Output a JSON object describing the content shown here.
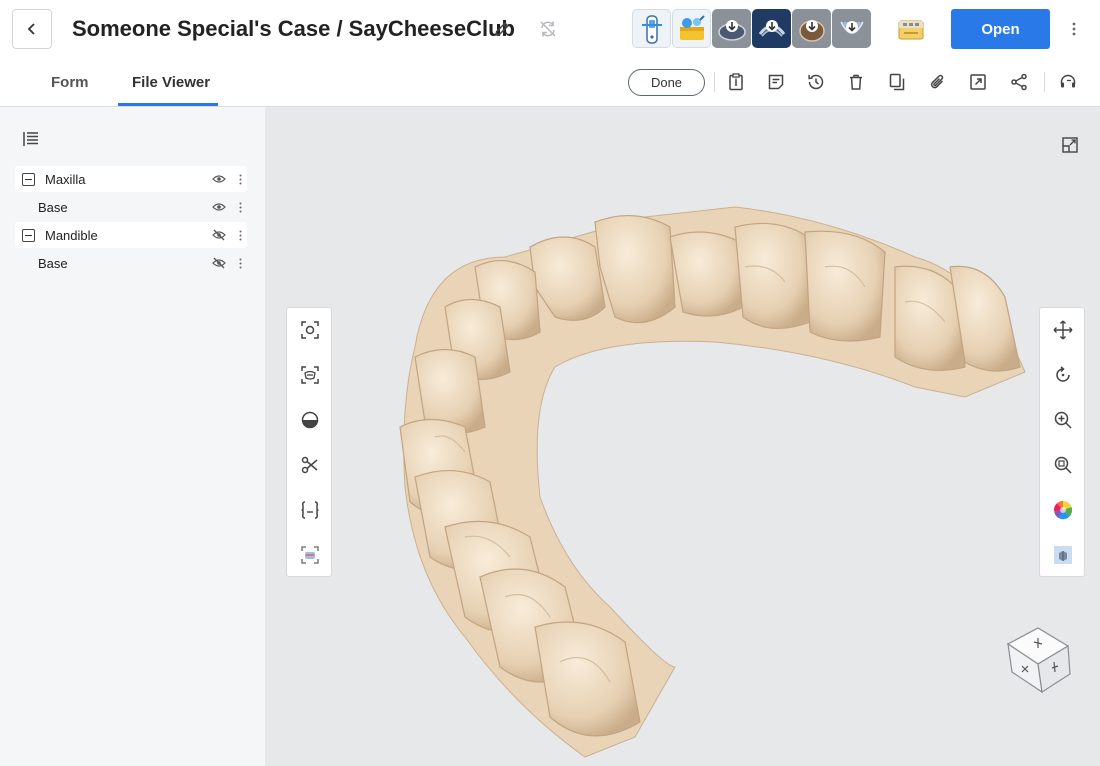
{
  "header": {
    "case_title": "Someone Special's Case / SayCheeseClub",
    "open_label": "Open",
    "icons": [
      "back-icon",
      "edit-icon",
      "sync-icon",
      "more-vert-icon"
    ],
    "apps": [
      "scanner-app-icon",
      "toolbox-app-icon",
      "download-app-icon",
      "download-app-icon",
      "download-app-icon",
      "download-app-icon",
      "storage-app-icon"
    ]
  },
  "tabs": [
    {
      "label": "Form",
      "active": false
    },
    {
      "label": "File Viewer",
      "active": true
    }
  ],
  "action_bar": {
    "done_label": "Done",
    "icons": [
      "clipboard-icon",
      "note-icon",
      "history-icon",
      "trash-icon",
      "copy-icon",
      "paperclip-icon",
      "export-icon",
      "share-icon",
      "headset-icon"
    ]
  },
  "layers": {
    "toggle_icon": "layer-list-icon",
    "items": [
      {
        "label": "Maxilla",
        "type": "group",
        "visible": true
      },
      {
        "label": "Base",
        "type": "child",
        "visible": true
      },
      {
        "label": "Mandible",
        "type": "group",
        "visible": false
      },
      {
        "label": "Base",
        "type": "child",
        "visible": false
      }
    ]
  },
  "viewer": {
    "left_tools": [
      "fit-view-icon",
      "scan-icon",
      "clipping-icon",
      "scissors-icon",
      "bracket-icon",
      "occlusion-icon"
    ],
    "right_tools": [
      "move-icon",
      "rotate-icon",
      "zoom-in-icon",
      "zoom-area-icon",
      "color-wheel-icon",
      "texture-icon"
    ],
    "corner_icon": "expand-icon",
    "orientation_icon": "view-cube-icon",
    "model_color": "#ecd8bd"
  },
  "colors": {
    "accent": "#2979e8",
    "sidebar_bg": "#f5f6f7",
    "viewer_bg": "#e7e8ea"
  }
}
